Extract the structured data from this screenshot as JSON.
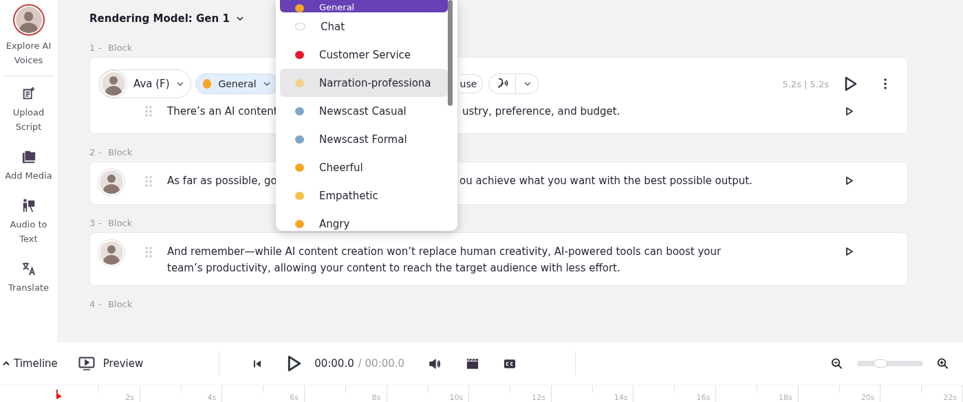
{
  "sidebar": {
    "items": [
      {
        "label": "Explore AI Voices"
      },
      {
        "label": "Upload Script"
      },
      {
        "label": "Add Media"
      },
      {
        "label": "Audio to Text"
      },
      {
        "label": "Translate"
      }
    ]
  },
  "rendering_model": "Rendering Model: Gen 1",
  "blocks": [
    {
      "number": "1 -",
      "label": "Block",
      "voice": "Ava (F)",
      "style": "General",
      "chip_partial": "use",
      "duration": "5.2s",
      "separator": "|",
      "total": "5.2s",
      "text_before": "There’s an AI content",
      "text_after": "ustry, preference, and budget."
    },
    {
      "number": "2 -",
      "label": "Block",
      "text_before": "As far as possible, go",
      "text_after": "ou achieve what you want with the best possible output."
    },
    {
      "number": "3 -",
      "label": "Block",
      "text": "And remember—while AI content creation won’t replace human creativity, AI-powered tools can boost your team’s productivity, allowing your content to reach the target audience with less effort."
    },
    {
      "number": "4 -",
      "label": "Block"
    }
  ],
  "style_menu": {
    "items": [
      {
        "label": "General",
        "selected": true,
        "highlighted": false
      },
      {
        "label": "Chat",
        "selected": false,
        "highlighted": false
      },
      {
        "label": "Customer Service",
        "selected": false,
        "highlighted": false
      },
      {
        "label": "Narration-professiona",
        "selected": false,
        "highlighted": true
      },
      {
        "label": "Newscast Casual",
        "selected": false,
        "highlighted": false
      },
      {
        "label": "Newscast Formal",
        "selected": false,
        "highlighted": false
      },
      {
        "label": "Cheerful",
        "selected": false,
        "highlighted": false
      },
      {
        "label": "Empathetic",
        "selected": false,
        "highlighted": false
      },
      {
        "label": "Angry",
        "selected": false,
        "highlighted": false
      }
    ]
  },
  "player": {
    "timeline": "Timeline",
    "preview": "Preview",
    "current": "00:00.0",
    "total": "/ 00:00.0",
    "zoom": {
      "level": 0.35
    }
  },
  "ruler": [
    "2s",
    "4s",
    "6s",
    "8s",
    "10s",
    "12s",
    "14s",
    "16s",
    "18s",
    "20s",
    "22s"
  ]
}
